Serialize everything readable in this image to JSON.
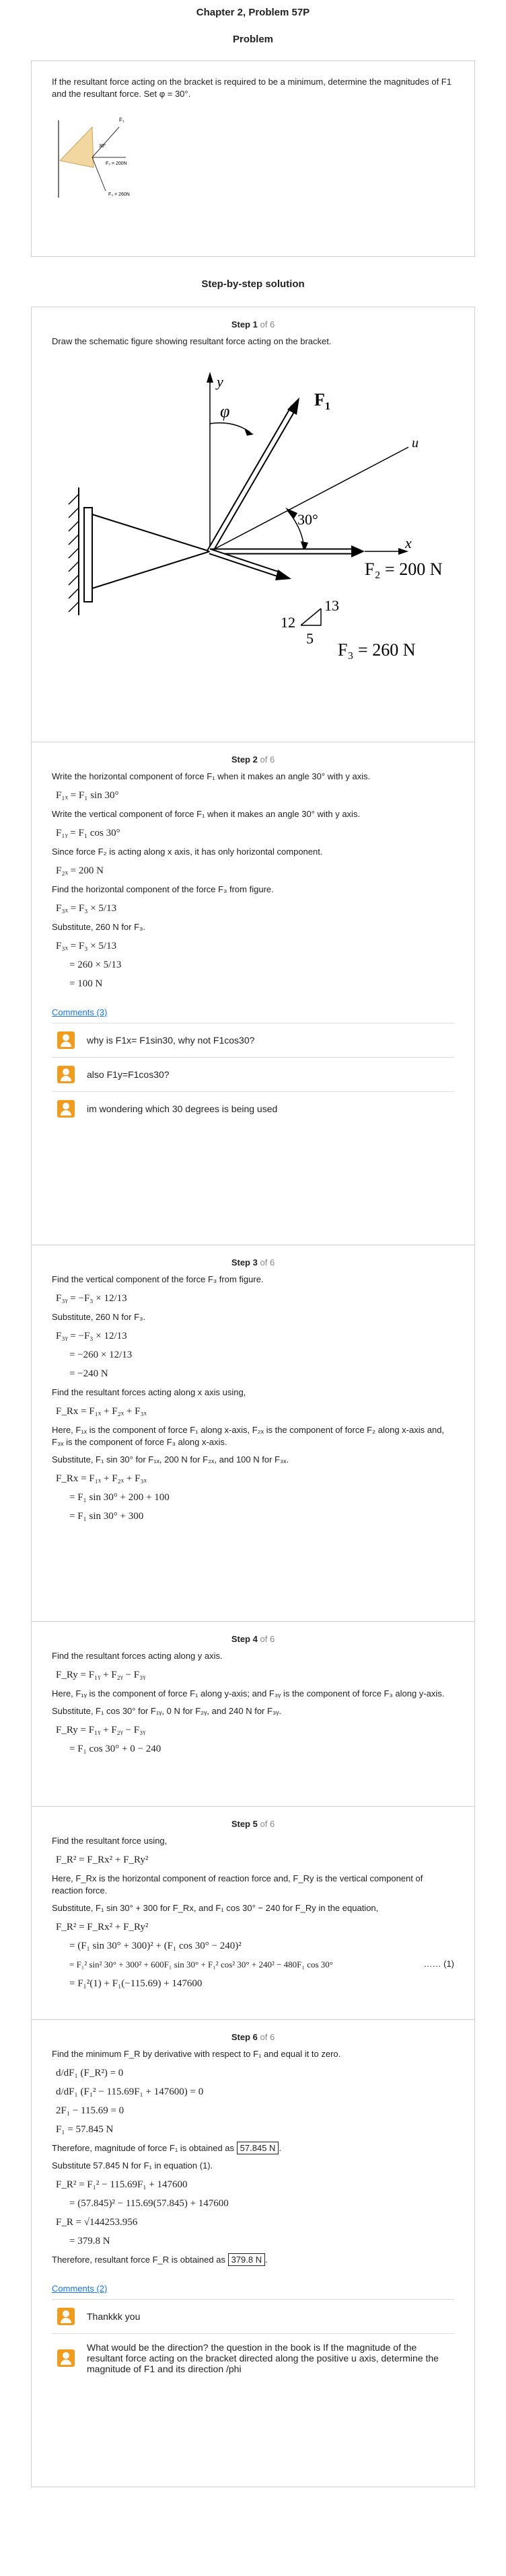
{
  "header": {
    "title": "Chapter 2, Problem 57P",
    "subtitle": "Problem"
  },
  "problem": {
    "text": "If the resultant force acting on the bracket is required to be a minimum, determine the magnitudes of F1 and the resultant force. Set φ = 30°.",
    "thumb_labels": {
      "f2": "F₂ = 200N",
      "f3": "F₃ = 260N",
      "angle": "30°"
    }
  },
  "solution_title": "Step-by-step solution",
  "steps": [
    {
      "num": "1",
      "of": "of 6",
      "text": "Draw the schematic figure showing resultant force acting on the bracket.",
      "figure": {
        "y": "y",
        "phi": "φ",
        "f1": "F",
        "f1sub": "1",
        "u": "u",
        "angle": "30°",
        "x": "x",
        "f2": "F₂ = 200 N",
        "n12": "12",
        "n13": "13",
        "n5": "5",
        "f3": "F₃ = 260 N"
      }
    },
    {
      "num": "2",
      "of": "of 6",
      "lines": [
        "Write the horizontal component of force F₁ when it makes an angle 30° with y axis.",
        "F₁ₓ = F₁ sin 30°",
        "Write the vertical component of force F₁ when it makes an angle 30° with y axis.",
        "F₁ᵧ = F₁ cos 30°",
        "Since force F₂ is acting along x axis, it has only horizontal component.",
        "F₂ₓ = 200 N",
        "Find the horizontal component of the force F₃ from figure.",
        "F₃ₓ = F₃ × 5/13",
        "Substitute, 260 N for F₃.",
        "F₃ₓ = F₃ × 5/13",
        "= 260 × 5/13",
        "= 100 N"
      ],
      "comments_label": "Comments (3)",
      "comments": [
        "why is F1x= F1sin30, why not F1cos30?",
        "also F1y=F1cos30?",
        "im wondering which 30 degrees is being used"
      ]
    },
    {
      "num": "3",
      "of": "of 6",
      "lines": [
        "Find the vertical component of the force F₃ from figure.",
        "F₃ᵧ = −F₃ × 12/13",
        "Substitute, 260 N for F₃.",
        "F₃ᵧ = −F₃ × 12/13",
        "= −260 × 12/13",
        "= −240 N",
        "Find the resultant forces acting along x axis using,",
        "F_Rx = F₁ₓ + F₂ₓ + F₃ₓ",
        "Here, F₁ₓ is the component of force F₁ along x-axis, F₂ₓ is the component of force F₂ along x-axis and, F₃ₓ is the component of force F₃ along x-axis.",
        "Substitute, F₁ sin 30° for F₁ₓ, 200 N for F₂ₓ, and 100 N for F₃ₓ.",
        "F_Rx = F₁ₓ + F₂ₓ + F₃ₓ",
        "= F₁ sin 30° + 200 + 100",
        "= F₁ sin 30° + 300"
      ]
    },
    {
      "num": "4",
      "of": "of 6",
      "lines": [
        "Find the resultant forces acting along y axis.",
        "F_Ry = F₁ᵧ + F₂ᵧ − F₃ᵧ",
        "Here, F₁ᵧ is the component of force F₁ along y-axis; and F₃ᵧ is the component of force F₃ along y-axis.",
        "Substitute, F₁ cos 30° for F₁ᵧ, 0 N for F₂ᵧ, and 240 N for F₃ᵧ.",
        "F_Ry = F₁ᵧ + F₂ᵧ − F₃ᵧ",
        "= F₁ cos 30° + 0 − 240"
      ]
    },
    {
      "num": "5",
      "of": "of 6",
      "lines": [
        "Find the resultant force using,",
        "F_R² = F_Rx² + F_Ry²",
        "Here, F_Rx is the horizontal component of reaction force and, F_Ry is the vertical component of reaction force.",
        "Substitute, F₁ sin 30° + 300 for F_Rx, and F₁ cos 30° − 240 for F_Ry in the equation,",
        "F_R² = F_Rx² + F_Ry²",
        "= (F₁ sin 30° + 300)² + (F₁ cos 30° − 240)²",
        "= F₁² sin² 30° + 300² + 600F₁ sin 30° + F₁² cos² 30° + 240² − 480F₁ cos 30°",
        "= F₁²(1) + F₁(−115.69) + 147600"
      ],
      "eq_number": "…… (1)"
    },
    {
      "num": "6",
      "of": "of 6",
      "lines": [
        "Find the minimum F_R by derivative with respect to F₁ and equal it to zero.",
        "d/dF₁ (F_R²) = 0",
        "d/dF₁ (F₁² − 115.69F₁ + 147600) = 0",
        "2F₁ − 115.69 = 0",
        "F₁ = 57.845 N",
        "Therefore, magnitude of force F₁ is obtained as",
        "Substitute 57.845 N for F₁ in equation (1).",
        "F_R² = F₁² − 115.69F₁ + 147600",
        "= (57.845)² − 115.69(57.845) + 147600",
        "F_R = √144253.956",
        "= 379.8 N",
        "Therefore, resultant force F_R is obtained as"
      ],
      "answer1": "57.845 N",
      "answer2": "379.8 N",
      "comments_label": "Comments (2)",
      "comments": [
        "Thankkk you",
        "What would be the direction? the question in the book is If the magnitude of the resultant force acting on the bracket directed along the positive u axis, determine the magnitude of F1 and its direction /phi"
      ]
    }
  ]
}
